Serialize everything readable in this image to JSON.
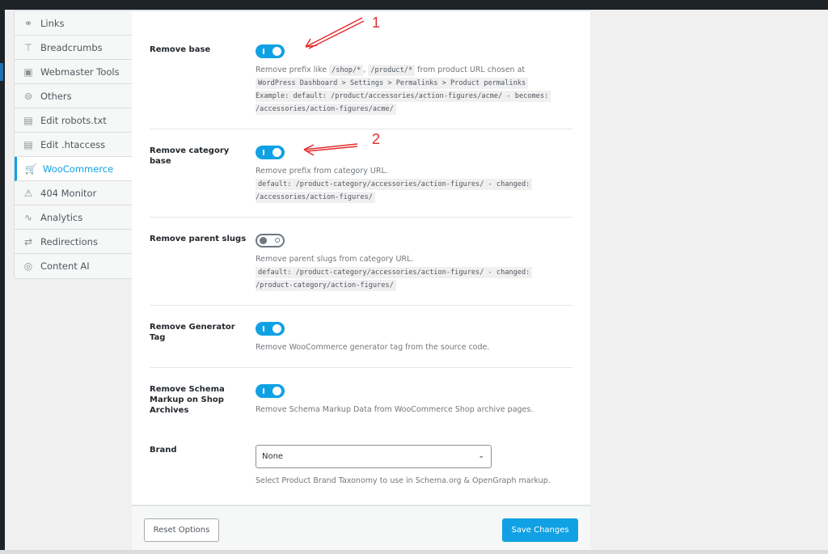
{
  "sidebar": {
    "items": [
      {
        "label": "Links",
        "icon": "link-icon"
      },
      {
        "label": "Breadcrumbs",
        "icon": "signpost-icon"
      },
      {
        "label": "Webmaster Tools",
        "icon": "toolbox-icon"
      },
      {
        "label": "Others",
        "icon": "list-circle-icon"
      },
      {
        "label": "Edit robots.txt",
        "icon": "file-robot-icon"
      },
      {
        "label": "Edit .htaccess",
        "icon": "file-text-icon"
      },
      {
        "label": "WooCommerce",
        "icon": "cart-icon",
        "active": true
      },
      {
        "label": "404 Monitor",
        "icon": "warning-icon"
      },
      {
        "label": "Analytics",
        "icon": "chart-icon"
      },
      {
        "label": "Redirections",
        "icon": "shuffle-icon"
      },
      {
        "label": "Content AI",
        "icon": "content-ai-icon"
      }
    ]
  },
  "settings": {
    "remove_base": {
      "label": "Remove base",
      "enabled": true,
      "desc_pre": "Remove prefix like",
      "code1": "/shop/*",
      "sep": ",",
      "code2": "/product/*",
      "desc_post": "from product URL chosen at",
      "code3": "WordPress Dashboard > Settings > Permalinks > Product permalinks",
      "code4": "Example: default: /product/accessories/action-figures/acme/ - becomes:",
      "code5": "/accessories/action-figures/acme/"
    },
    "remove_category_base": {
      "label": "Remove category base",
      "enabled": true,
      "desc": "Remove prefix from category URL.",
      "code1": "default: /product-category/accessories/action-figures/ - changed:",
      "code2": "/accessories/action-figures/"
    },
    "remove_parent_slugs": {
      "label": "Remove parent slugs",
      "enabled": false,
      "desc": "Remove parent slugs from category URL.",
      "code1": "default: /product-category/accessories/action-figures/ - changed:",
      "code2": "/product-category/action-figures/"
    },
    "remove_generator_tag": {
      "label": "Remove Generator Tag",
      "enabled": true,
      "desc": "Remove WooCommerce generator tag from the source code."
    },
    "remove_schema_markup": {
      "label": "Remove Schema Markup on Shop Archives",
      "enabled": true,
      "desc": "Remove Schema Markup Data from WooCommerce Shop archive pages."
    },
    "brand": {
      "label": "Brand",
      "value": "None",
      "desc": "Select Product Brand Taxonomy to use in Schema.org & OpenGraph markup."
    }
  },
  "footer": {
    "reset_label": "Reset Options",
    "save_label": "Save Changes"
  },
  "annotations": {
    "one": "1",
    "two": "2",
    "color": "#e32b2b"
  },
  "colors": {
    "accent": "#10a1e5"
  }
}
